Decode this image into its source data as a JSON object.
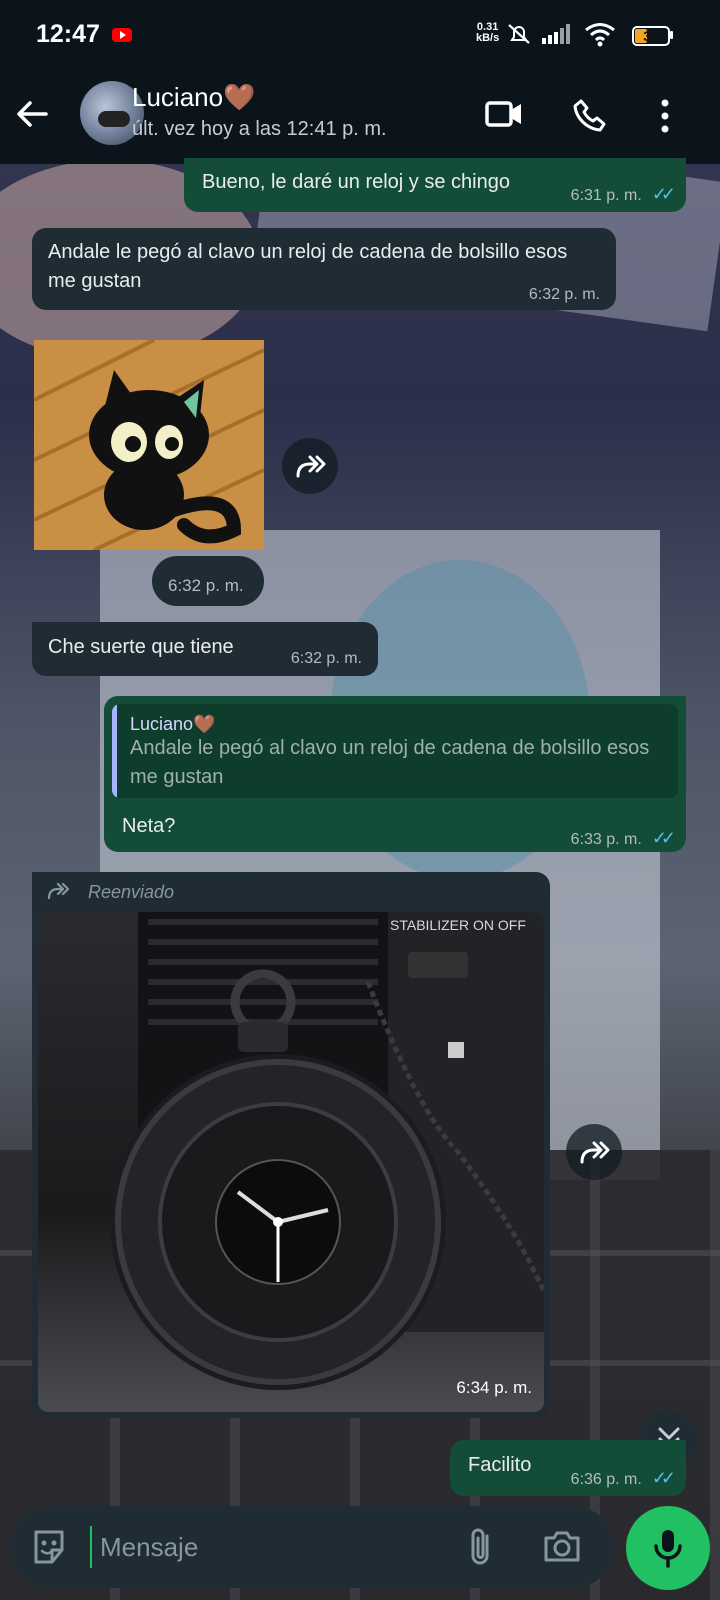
{
  "status_bar": {
    "time": "12:47",
    "net_speed_value": "0.31",
    "net_speed_unit": "kB/s",
    "battery": "39",
    "battery_level": 0.39
  },
  "header": {
    "contact_name": "Luciano",
    "contact_emoji": "🤎",
    "last_seen": "últ. vez hoy a las 12:41 p. m."
  },
  "messages": [
    {
      "dir": "out",
      "text": "Bueno, le daré un reloj y se chingo",
      "time": "6:31 p. m.",
      "read": true
    },
    {
      "dir": "in",
      "text": "Andale le pegó al clavo un reloj de cadena de bolsillo esos me gustan",
      "time": "6:32 p. m."
    },
    {
      "dir": "in",
      "type": "sticker",
      "time": "6:32 p. m."
    },
    {
      "dir": "in",
      "text": "Che suerte que tiene",
      "time": "6:32 p. m."
    },
    {
      "dir": "out",
      "reply_to_name": "Luciano🤎",
      "reply_to_text": "Andale le pegó al clavo un reloj de cadena de bolsillo esos me gustan",
      "text": "Neta?",
      "time": "6:33 p. m.",
      "read": true
    },
    {
      "dir": "in",
      "type": "image",
      "forwarded_label": "Reenviado",
      "time": "6:34 p. m.",
      "image_text": "STABILIZER ON OFF"
    },
    {
      "dir": "out",
      "text": "Facilito",
      "time": "6:36 p. m.",
      "read": true
    }
  ],
  "input": {
    "placeholder": "Mensaje"
  },
  "colors": {
    "outgoing_bubble": "#144d37",
    "incoming_bubble": "#1f2c34",
    "accent": "#21c063",
    "read_ticks": "#53bdeb"
  }
}
